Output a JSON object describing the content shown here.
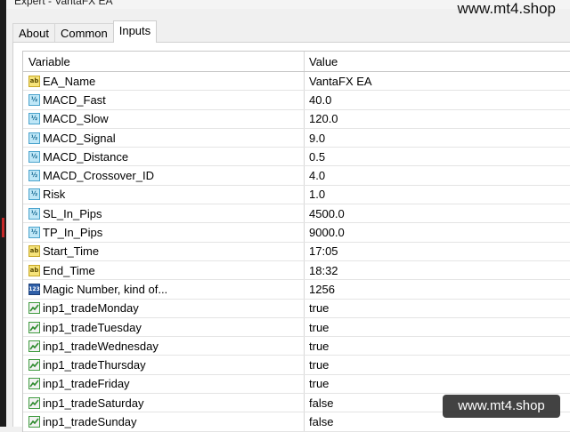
{
  "window": {
    "title": "Expert - VantaFX EA"
  },
  "watermark": {
    "top": "www.mt4.shop",
    "bottom": "www.mt4.shop"
  },
  "tabs": [
    {
      "label": "About",
      "active": false
    },
    {
      "label": "Common",
      "active": false
    },
    {
      "label": "Inputs",
      "active": true
    }
  ],
  "table": {
    "headers": {
      "variable": "Variable",
      "value": "Value"
    },
    "rows": [
      {
        "icon": "string-icon",
        "name": "EA_Name",
        "value": "VantaFX EA"
      },
      {
        "icon": "double-icon",
        "name": "MACD_Fast",
        "value": "40.0"
      },
      {
        "icon": "double-icon",
        "name": "MACD_Slow",
        "value": "120.0"
      },
      {
        "icon": "double-icon",
        "name": "MACD_Signal",
        "value": "9.0"
      },
      {
        "icon": "double-icon",
        "name": "MACD_Distance",
        "value": "0.5"
      },
      {
        "icon": "double-icon",
        "name": "MACD_Crossover_ID",
        "value": "4.0"
      },
      {
        "icon": "double-icon",
        "name": "Risk",
        "value": "1.0"
      },
      {
        "icon": "double-icon",
        "name": "SL_In_Pips",
        "value": "4500.0"
      },
      {
        "icon": "double-icon",
        "name": "TP_In_Pips",
        "value": "9000.0"
      },
      {
        "icon": "string-icon",
        "name": "Start_Time",
        "value": "17:05"
      },
      {
        "icon": "string-icon",
        "name": "End_Time",
        "value": "18:32"
      },
      {
        "icon": "integer-icon",
        "name": "Magic Number, kind of...",
        "value": "1256"
      },
      {
        "icon": "bool-icon",
        "name": "inp1_tradeMonday",
        "value": "true"
      },
      {
        "icon": "bool-icon",
        "name": "inp1_tradeTuesday",
        "value": "true"
      },
      {
        "icon": "bool-icon",
        "name": "inp1_tradeWednesday",
        "value": "true"
      },
      {
        "icon": "bool-icon",
        "name": "inp1_tradeThursday",
        "value": "true"
      },
      {
        "icon": "bool-icon",
        "name": "inp1_tradeFriday",
        "value": "true"
      },
      {
        "icon": "bool-icon",
        "name": "inp1_tradeSaturday",
        "value": "false"
      },
      {
        "icon": "bool-icon",
        "name": "inp1_tradeSunday",
        "value": "false"
      }
    ]
  }
}
